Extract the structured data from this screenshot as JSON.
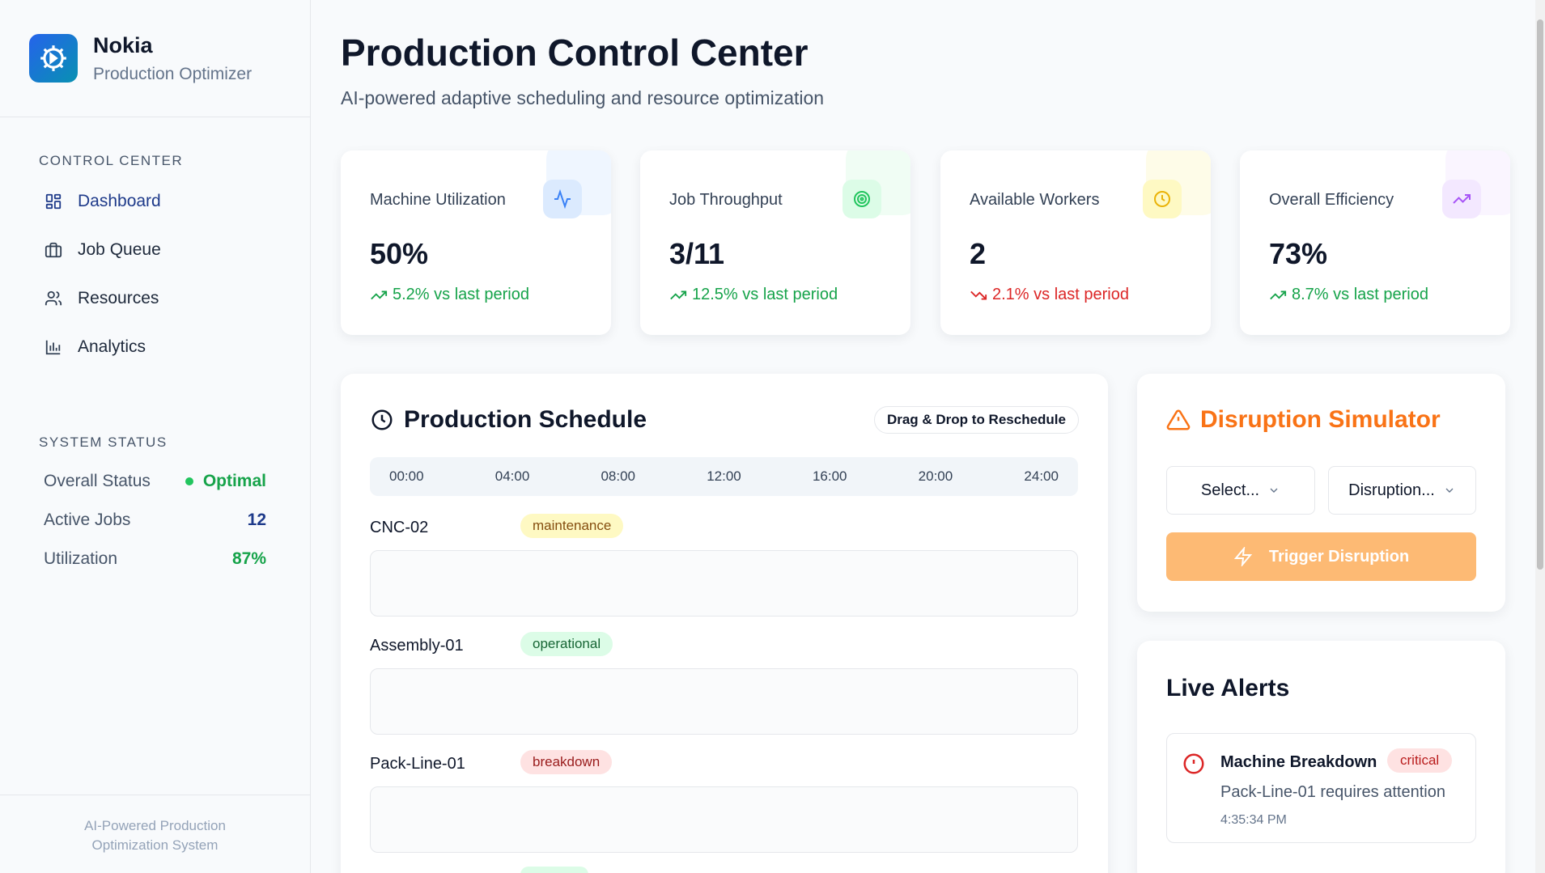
{
  "brand": {
    "name": "Nokia",
    "subtitle": "Production Optimizer"
  },
  "sidebar": {
    "control_title": "CONTROL CENTER",
    "nav": [
      {
        "label": "Dashboard",
        "icon": "dashboard-grid-icon",
        "active": true
      },
      {
        "label": "Job Queue",
        "icon": "briefcase-icon"
      },
      {
        "label": "Resources",
        "icon": "users-icon"
      },
      {
        "label": "Analytics",
        "icon": "bar-chart-icon"
      }
    ],
    "status_title": "SYSTEM STATUS",
    "status": [
      {
        "label": "Overall Status",
        "value": "Optimal",
        "color": "#16a34a"
      },
      {
        "label": "Active Jobs",
        "value": "12",
        "color": "#1e3a8a"
      },
      {
        "label": "Utilization",
        "value": "87%",
        "color": "#16a34a"
      }
    ],
    "footer_line1": "AI-Powered Production",
    "footer_line2": "Optimization System"
  },
  "header": {
    "title": "Production Control Center",
    "subtitle": "AI-powered adaptive scheduling and resource optimization"
  },
  "kpis": [
    {
      "label": "Machine Utilization",
      "value": "50%",
      "delta": "5.2% vs last period",
      "trend": "up",
      "icon": "activity-icon",
      "accent": "#3b82f6"
    },
    {
      "label": "Job Throughput",
      "value": "3/11",
      "delta": "12.5% vs last period",
      "trend": "up",
      "icon": "target-icon",
      "accent": "#22c55e"
    },
    {
      "label": "Available Workers",
      "value": "2",
      "delta": "2.1% vs last period",
      "trend": "down",
      "icon": "clock-icon",
      "accent": "#eab308"
    },
    {
      "label": "Overall Efficiency",
      "value": "73%",
      "delta": "8.7% vs last period",
      "trend": "up",
      "icon": "trending-up-icon",
      "accent": "#a855f7"
    }
  ],
  "schedule": {
    "title": "Production Schedule",
    "badge": "Drag & Drop to Reschedule",
    "timeline": [
      "00:00",
      "04:00",
      "08:00",
      "12:00",
      "16:00",
      "20:00",
      "24:00"
    ],
    "machines": [
      {
        "name": "CNC-02",
        "status": "maintenance"
      },
      {
        "name": "Assembly-01",
        "status": "operational"
      },
      {
        "name": "Pack-Line-01",
        "status": "breakdown"
      }
    ]
  },
  "simulator": {
    "title": "Disruption Simulator",
    "select1": "Select...",
    "select2": "Disruption...",
    "trigger": "Trigger Disruption"
  },
  "alerts": {
    "title": "Live Alerts",
    "items": [
      {
        "title": "Machine Breakdown",
        "severity": "critical",
        "message": "Pack-Line-01 requires attention",
        "time": "4:35:34 PM"
      }
    ]
  }
}
